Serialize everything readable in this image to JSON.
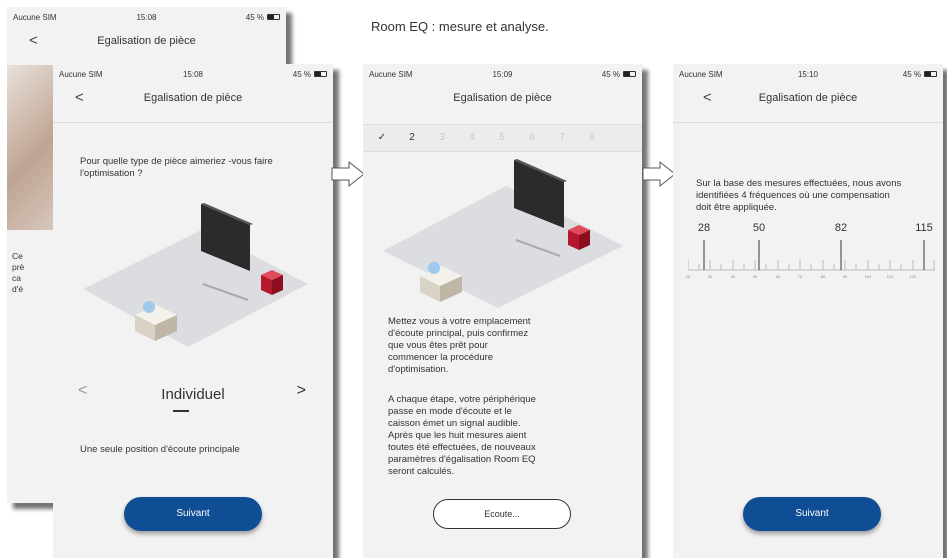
{
  "caption": "Room EQ : mesure et analyse.",
  "status": {
    "carrier": "Aucune SIM",
    "battery": "45 %",
    "times": [
      "15:08",
      "15:08",
      "15:09",
      "15:10"
    ]
  },
  "screen_title": "Egalisation de pièce",
  "back_glyph": "<",
  "behind": {
    "partial_text": [
      "Ce",
      "prè",
      "ca",
      "d'é"
    ]
  },
  "screen1": {
    "question": "Pour quelle type de pièce aimeriez -vous faire l'optimisation ?",
    "prev_glyph": "<",
    "next_glyph": ">",
    "room_type": "Individuel",
    "description": "Une seule position d'écoute principale",
    "button": "Suivant"
  },
  "screen2": {
    "steps": [
      "✓",
      "2",
      "3",
      "4",
      "5",
      "6",
      "7",
      "8"
    ],
    "active_step": "2",
    "paragraph1": "Mettez vous à votre emplacement d'écoute principal, puis confirmez que vous êtes prêt pour commencer la procédure d'optimisation.",
    "paragraph2": "A chaque étape, votre périphérique passe en mode d'écoute et le caisson émet un signal audible. Après que les huit mesures aient toutes été effectuées, de nouveaux paramètres d'égalisation Room EQ seront calculés.",
    "button": "Ecoute..."
  },
  "screen3": {
    "summary": "Sur la base des mesures effectuées, nous avons identifiées 4 fréquences où une compensation doit être appliquée.",
    "frequencies": [
      "28",
      "50",
      "82",
      "115"
    ],
    "scale_labels": [
      "20",
      "30",
      "40",
      "50",
      "60",
      "70",
      "80",
      "90",
      "100",
      "110",
      "120"
    ],
    "button": "Suivant"
  },
  "colors": {
    "primary_button": "#0f4d94",
    "subwoofer": "#b3182c",
    "floor": "#dcdde0"
  }
}
